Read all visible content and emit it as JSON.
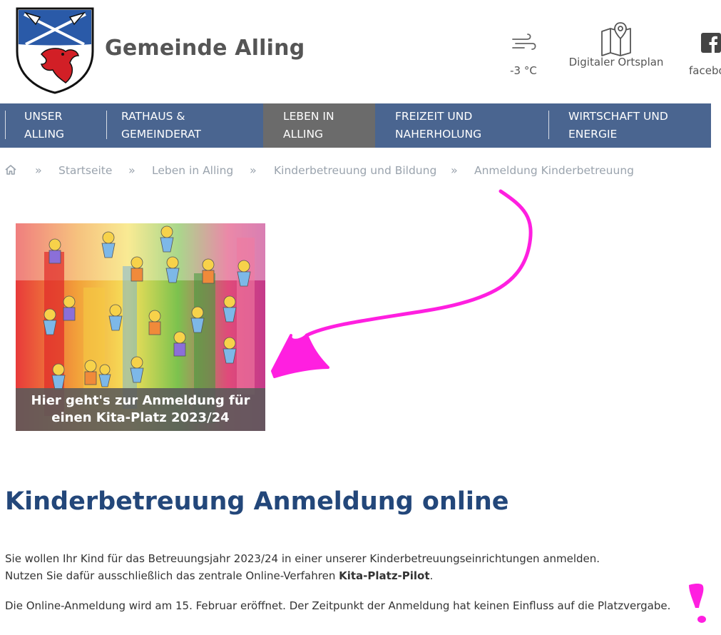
{
  "header": {
    "site_title": "Gemeinde Alling",
    "weather": {
      "icon": "wind-icon",
      "value": "-3 °C"
    },
    "ortsplan": {
      "icon": "map-pin-icon",
      "label": "Digitaler Ortsplan"
    },
    "facebook": {
      "icon": "facebook-icon",
      "label": "facebo"
    }
  },
  "nav": {
    "items": [
      {
        "line1": "UNSER",
        "line2": "ALLING"
      },
      {
        "line1": "RATHAUS &",
        "line2": "GEMEINDERAT"
      },
      {
        "line1": "LEBEN IN",
        "line2": "ALLING"
      },
      {
        "line1": "FREIZEIT UND",
        "line2": "NAHERHOLUNG"
      },
      {
        "line1": "WIRTSCHAFT UND",
        "line2": "ENERGIE"
      }
    ],
    "active_index": 2
  },
  "breadcrumb": {
    "home_icon": "home-icon",
    "items": [
      "Startseite",
      "Leben in Alling",
      "Kinderbetreuung und Bildung",
      "Anmeldung Kinderbetreuung"
    ],
    "separator": "»"
  },
  "teaser": {
    "caption_line1": "Hier geht's zur Anmeldung für",
    "caption_line2": "einen Kita-Platz 2023/24"
  },
  "main": {
    "title": "Kinderbetreuung Anmeldung online",
    "para1_line1": "Sie wollen Ihr Kind für das Betreuungsjahr 2023/24 in einer unserer Kinderbetreuungseinrichtungen anmelden.",
    "para1_line2_prefix": "Nutzen Sie dafür ausschließlich das zentrale Online-Verfahren ",
    "para1_line2_bold": "Kita-Platz-Pilot",
    "para1_line2_suffix": ".",
    "para2": "Die Online-Anmeldung wird am 15. Februar eröffnet. Der Zeitpunkt der Anmeldung hat keinen Einfluss auf die Platzvergabe."
  },
  "colors": {
    "nav_bg": "#4a6590",
    "nav_active_bg": "#6b6b6b",
    "title_color": "#23477a",
    "annotation": "#ff1fe0"
  }
}
